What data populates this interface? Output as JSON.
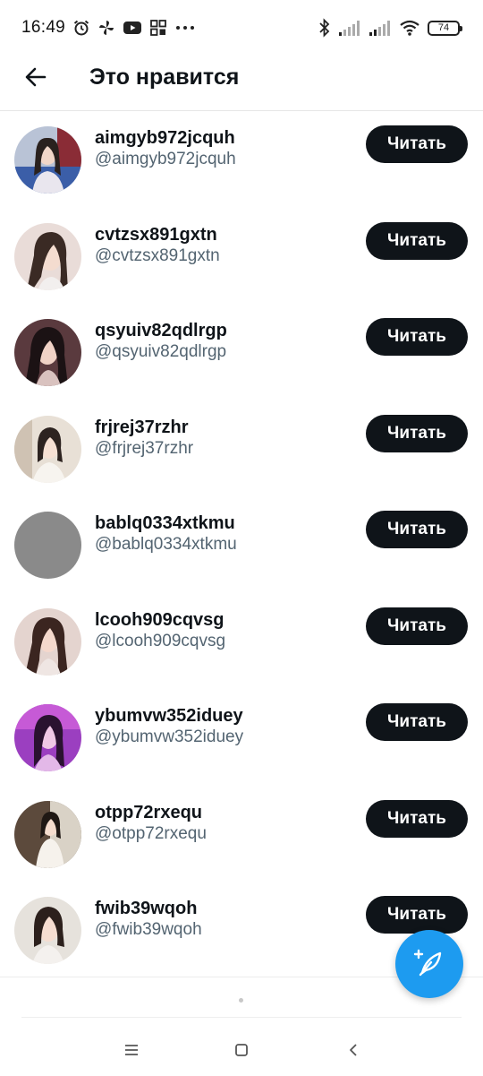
{
  "status_bar": {
    "time": "16:49",
    "battery": "74",
    "left_icons": [
      "alarm-icon",
      "pinwheel-icon",
      "youtube-icon",
      "app-grid-icon",
      "more-icon"
    ],
    "right_icons": [
      "bluetooth-icon",
      "signal-icon",
      "signal-icon",
      "wifi-icon",
      "battery-icon"
    ]
  },
  "header": {
    "title": "Это нравится",
    "back_icon": "arrow-left-icon"
  },
  "users": [
    {
      "name": "aimgyb972jcquh",
      "handle": "@aimgyb972jcquh",
      "follow_label": "Читать",
      "avatar": "photo"
    },
    {
      "name": "cvtzsx891gxtn",
      "handle": "@cvtzsx891gxtn",
      "follow_label": "Читать",
      "avatar": "photo"
    },
    {
      "name": "qsyuiv82qdlrgp",
      "handle": "@qsyuiv82qdlrgp",
      "follow_label": "Читать",
      "avatar": "photo"
    },
    {
      "name": "frjrej37rzhr",
      "handle": "@frjrej37rzhr",
      "follow_label": "Читать",
      "avatar": "photo"
    },
    {
      "name": "bablq0334xtkmu",
      "handle": "@bablq0334xtkmu",
      "follow_label": "Читать",
      "avatar": "gray-placeholder"
    },
    {
      "name": "lcooh909cqvsg",
      "handle": "@lcooh909cqvsg",
      "follow_label": "Читать",
      "avatar": "photo"
    },
    {
      "name": "ybumvw352iduey",
      "handle": "@ybumvw352iduey",
      "follow_label": "Читать",
      "avatar": "photo"
    },
    {
      "name": "otpp72rxequ",
      "handle": "@otpp72rxequ",
      "follow_label": "Читать",
      "avatar": "photo"
    },
    {
      "name": "fwib39wqoh",
      "handle": "@fwib39wqoh",
      "follow_label": "Читать",
      "avatar": "photo"
    }
  ],
  "fab": {
    "icon": "compose-feather-plus-icon"
  },
  "nav_bar": {
    "icons": [
      "menu-icon",
      "home-square-icon",
      "back-chevron-icon"
    ]
  },
  "colors": {
    "button_bg": "#0f1419",
    "button_text": "#ffffff",
    "handle_text": "#536471",
    "fab_bg": "#1d9bf0",
    "avatar_placeholder": "#8a8a8a"
  }
}
